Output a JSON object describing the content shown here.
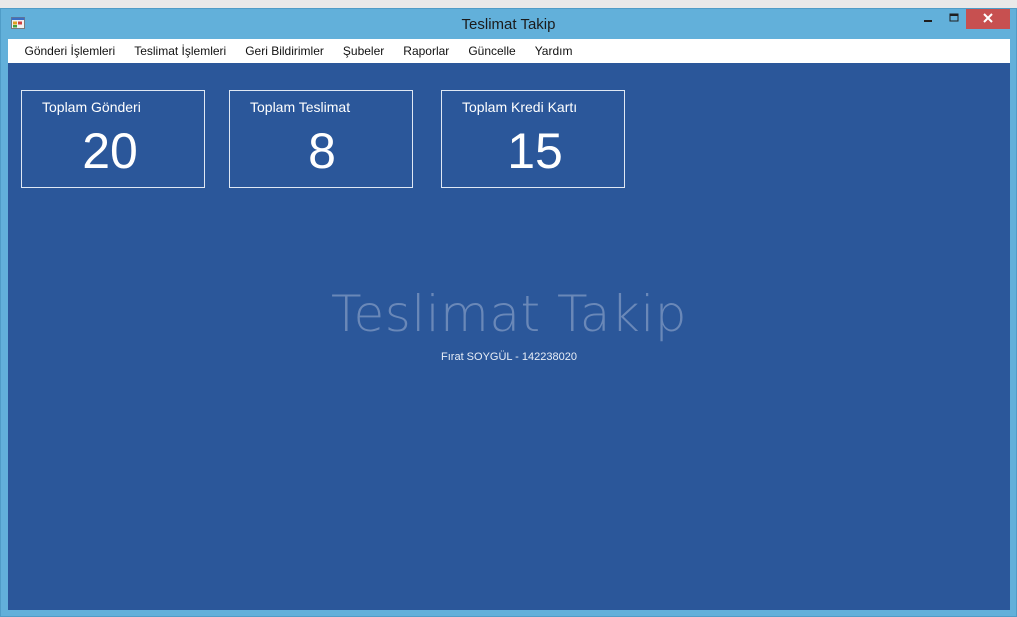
{
  "window": {
    "title": "Teslimat Takip",
    "icon": "app-window-icon",
    "controls": [
      "minimize-icon",
      "maximize-icon",
      "close-icon"
    ]
  },
  "menu": {
    "items": [
      {
        "label": "Gönderi İşlemleri"
      },
      {
        "label": "Teslimat İşlemleri"
      },
      {
        "label": "Geri Bildirimler"
      },
      {
        "label": "Şubeler"
      },
      {
        "label": "Raporlar"
      },
      {
        "label": "Güncelle"
      },
      {
        "label": "Yardım"
      }
    ]
  },
  "stats": [
    {
      "label": "Toplam Gönderi",
      "value": "20"
    },
    {
      "label": "Toplam Teslimat",
      "value": "8"
    },
    {
      "label": "Toplam Kredi Kartı",
      "value": "15"
    }
  ],
  "main": {
    "watermark": "Teslimat Takip",
    "author": "Fırat SOYGÜL - 142238020"
  },
  "colors": {
    "window_frame": "#62b0da",
    "client_background": "#2b579a",
    "close_button": "#c75050",
    "watermark_text": "#6a88b8"
  }
}
